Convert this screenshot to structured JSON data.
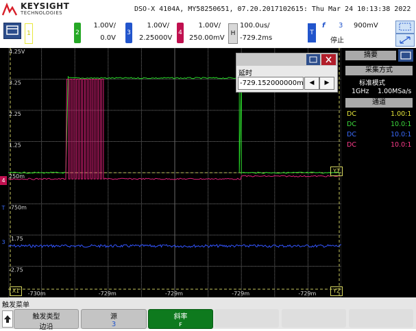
{
  "header": {
    "brand": "KEYSIGHT",
    "brand_sub": "TECHNOLOGIES",
    "instrument_info": "DSO-X 4104A, MY58250651, 07.20.2017102615: Thu Mar 24 10:13:38 2022"
  },
  "channels": [
    {
      "num": "1",
      "color": "#e8e83a"
    },
    {
      "num": "2",
      "color": "#26a826",
      "scale": "1.00V/",
      "offset": "0.0V"
    },
    {
      "num": "3",
      "color": "#2255cc",
      "scale": "1.00V/",
      "offset": "2.25000V"
    },
    {
      "num": "4",
      "color": "#c0104f",
      "scale": "1.00V/",
      "offset": "250.00mV"
    }
  ],
  "timebase": {
    "icon": "H",
    "scale": "100.0us/",
    "delay": "-729.2ms"
  },
  "trigger": {
    "icon": "T",
    "slope_symbol": "f",
    "source": "3",
    "level": "900mV",
    "status": "停止"
  },
  "y_labels": [
    "4.25V",
    "3.25",
    "2.25",
    "1.25",
    "250m",
    "-750m",
    "-1.75",
    "-2.75"
  ],
  "x_labels": [
    "-730m",
    "-729m",
    "-729m",
    "-729m",
    "-729m"
  ],
  "markers": {
    "x1": "X1",
    "x2": "X2",
    "y1": "Y1",
    "y2": "Y2",
    "ch4": "4",
    "ch3": "3",
    "trig": "T"
  },
  "delay_popup": {
    "title": "延时",
    "value": "-729.152000000ms",
    "left_arrow": "◀",
    "right_arrow": "▶"
  },
  "right_panel": {
    "tab": "摘要",
    "acq_header": "采集方式",
    "acq_mode": "标准模式",
    "bandwidth": "1GHz",
    "sample_rate": "1.00MSa/s",
    "chan_header": "通道",
    "rows": [
      {
        "coupling": "DC",
        "probe": "1.00:1",
        "color": "#e8e83a"
      },
      {
        "coupling": "DC",
        "probe": "10.0:1",
        "color": "#3ddc3d"
      },
      {
        "coupling": "DC",
        "probe": "10.0:1",
        "color": "#3b6cff"
      },
      {
        "coupling": "DC",
        "probe": "10.0:1",
        "color": "#ff3c8c"
      }
    ]
  },
  "menu": {
    "title": "触发菜单",
    "softkeys": [
      {
        "label": "触发类型",
        "value": "边沿"
      },
      {
        "label": "源",
        "value": "3"
      },
      {
        "label": "斜率",
        "value": "ꜰ"
      }
    ]
  },
  "chart_data": {
    "type": "line",
    "title": "",
    "xlabel": "",
    "ylabel": "",
    "ylim": [
      -3.75,
      4.25
    ],
    "grid": true,
    "series": [
      {
        "color": "#27d827",
        "x": [
          0.0,
          0.17,
          0.18,
          0.69,
          0.695,
          0.7,
          1.0
        ],
        "y": [
          0.25,
          0.25,
          3.35,
          3.35,
          3.35,
          0.25,
          0.25
        ]
      },
      {
        "color": "#e0207a",
        "x": [
          0.0,
          0.176,
          0.18,
          0.29,
          0.3,
          0.7,
          0.71,
          1.0
        ],
        "y": [
          0.05,
          0.05,
          3.25,
          3.25,
          0.05,
          0.05,
          0.05,
          0.05
        ],
        "burst_pulses": 12
      },
      {
        "color": "#3355ff",
        "x": [
          0.0,
          1.0
        ],
        "y": [
          -2.1,
          -2.1
        ]
      },
      {
        "color": "#d8d860",
        "x": [
          0.0,
          1.0
        ],
        "y": [
          0.25,
          0.25
        ]
      }
    ]
  }
}
